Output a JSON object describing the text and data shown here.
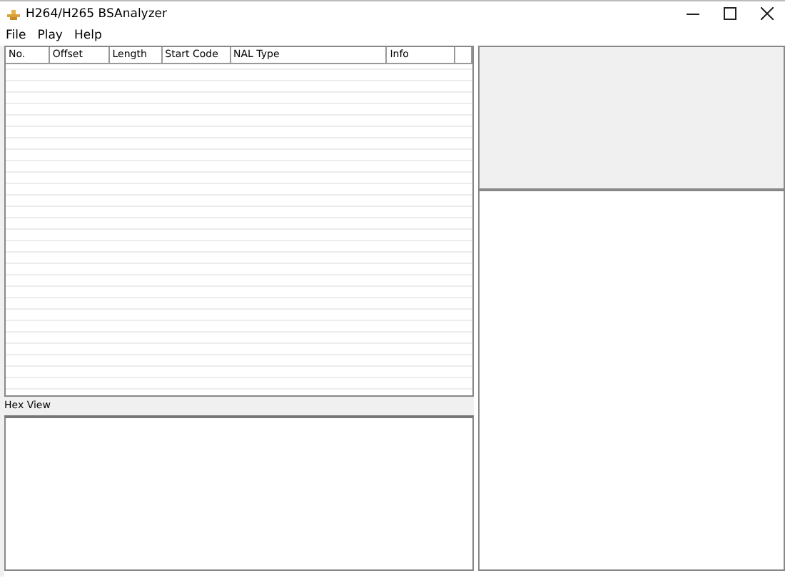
{
  "window": {
    "title": "H264/H265 BSAnalyzer"
  },
  "menu": [
    "File",
    "Play",
    "Help"
  ],
  "table": {
    "columns": [
      "No.",
      "Offset",
      "Length",
      "Start Code",
      "NAL Type",
      "Info"
    ]
  },
  "hex_view": {
    "label": "Hex View"
  }
}
